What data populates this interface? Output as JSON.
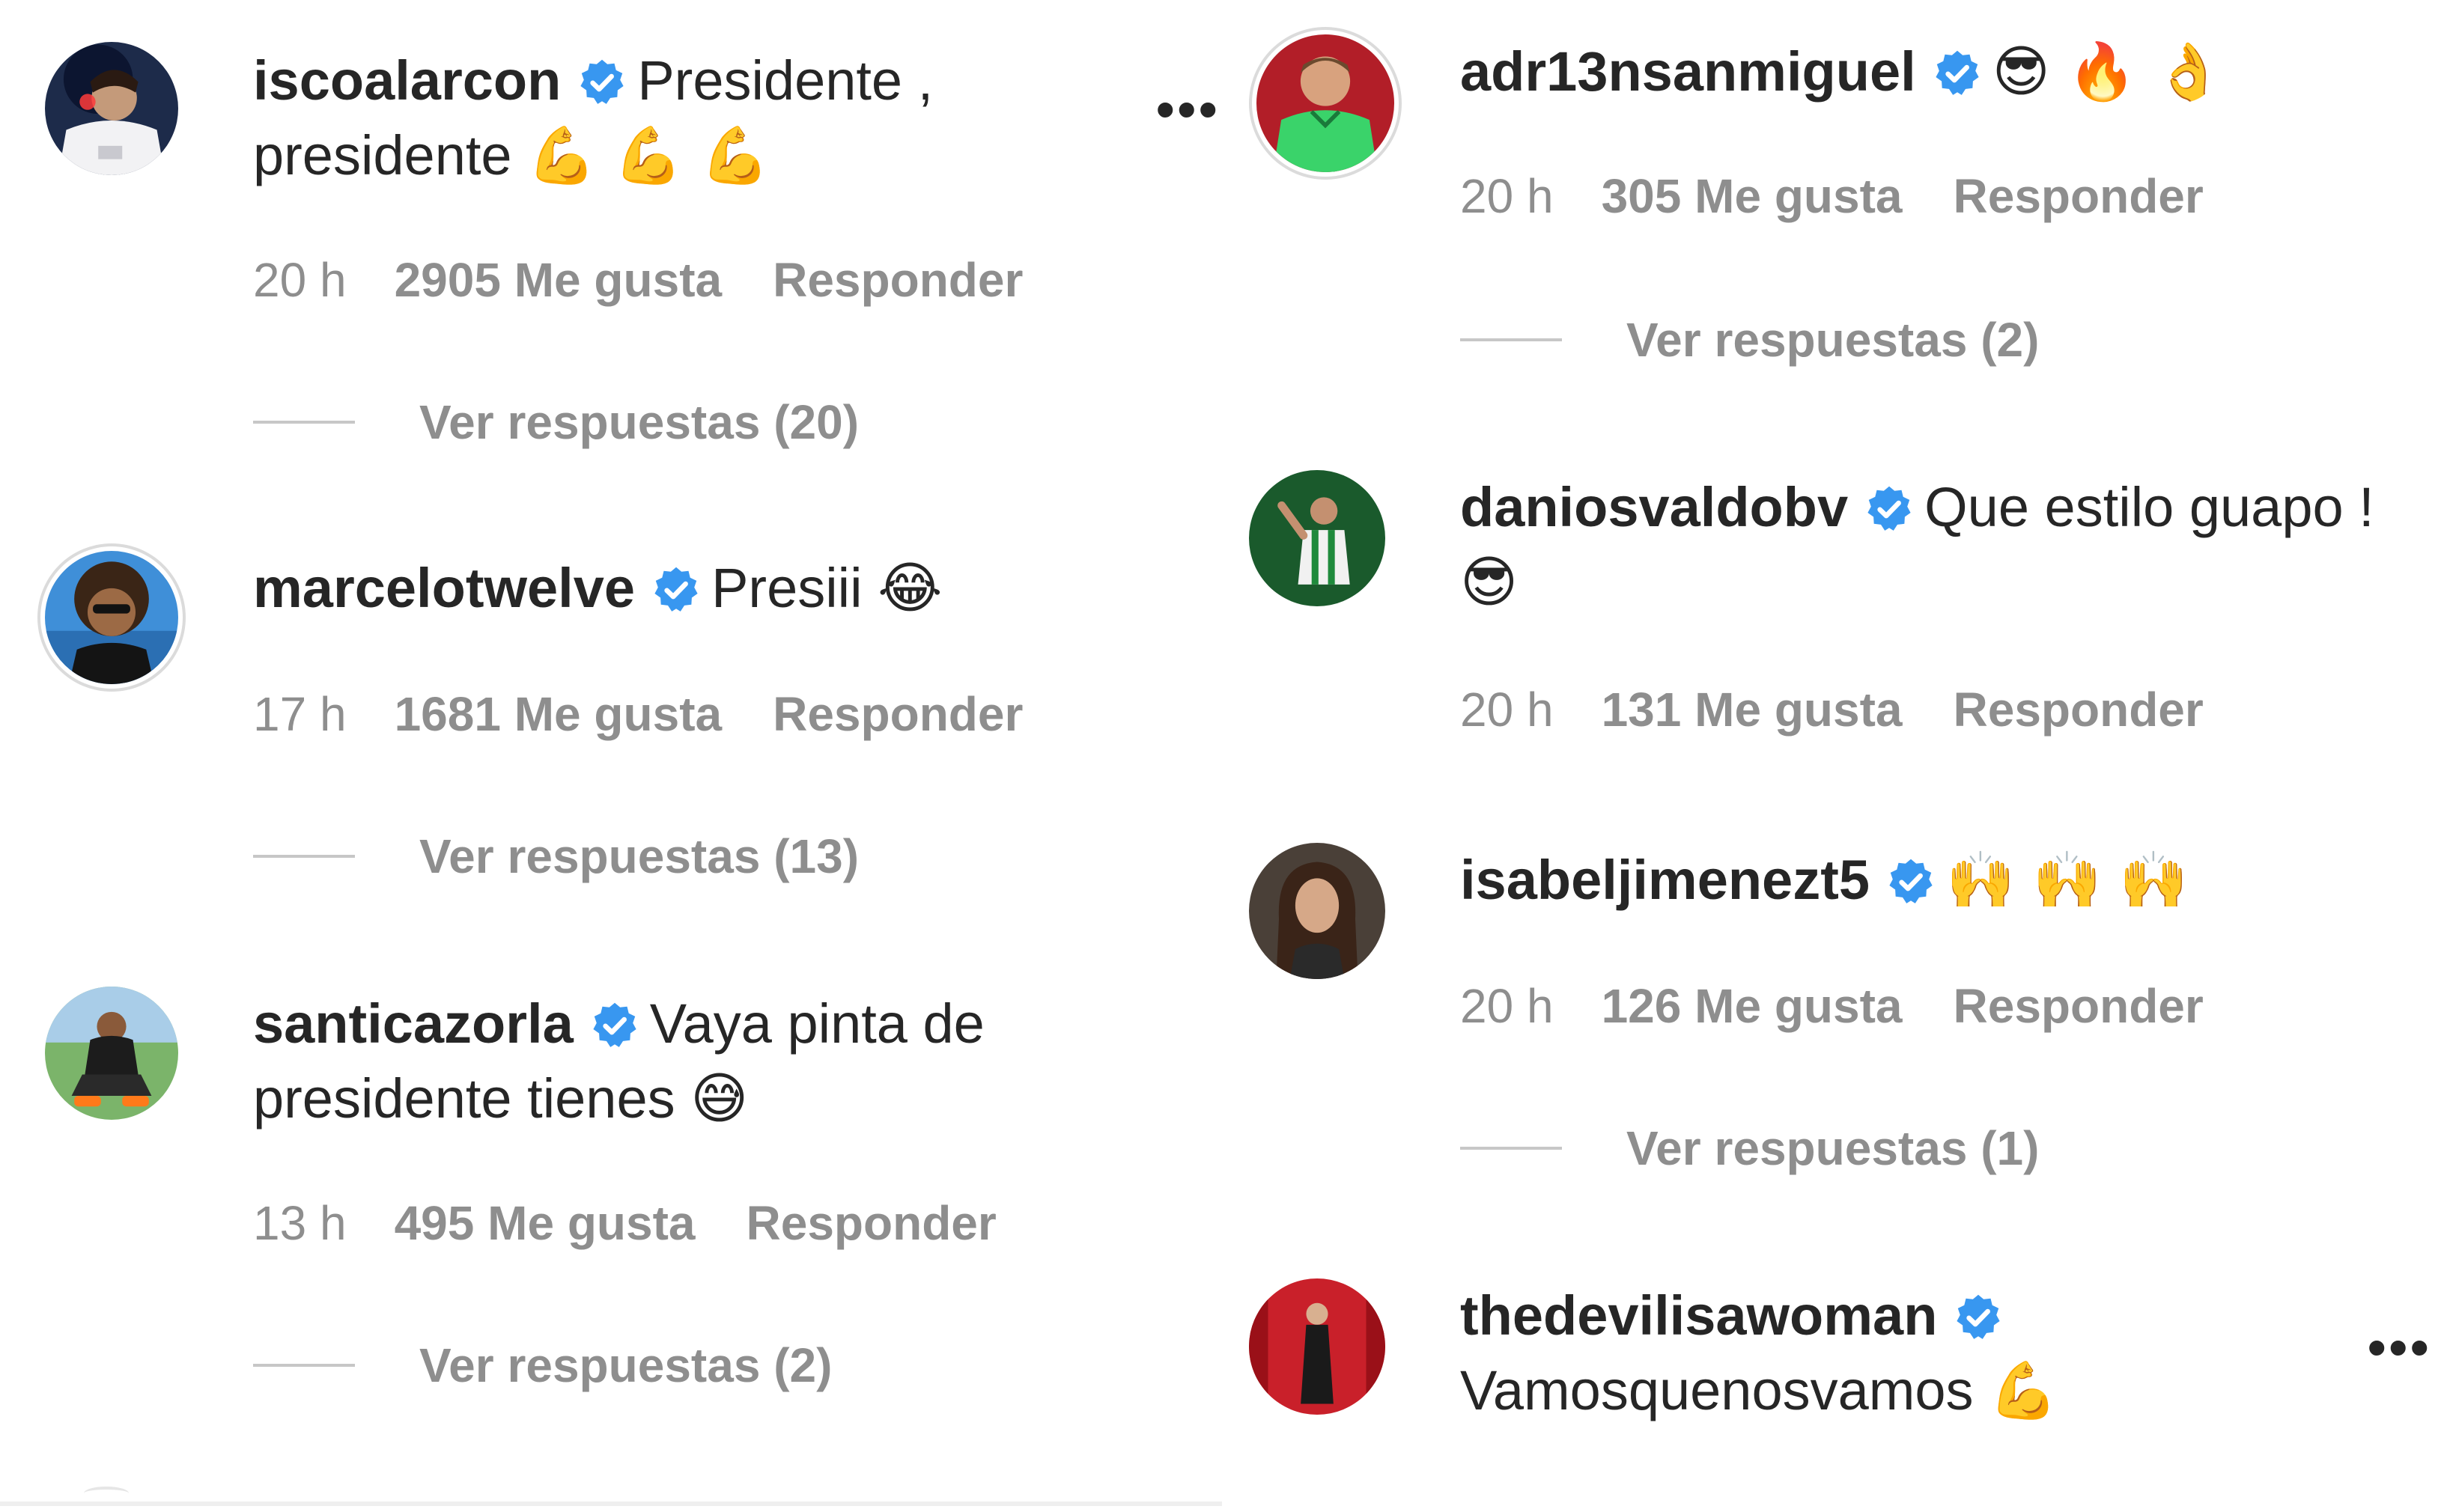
{
  "verified_color": "#3897f0",
  "text_color": "#262626",
  "meta_color": "#8e8e8e",
  "comments": [
    {
      "username": "iscoalarcon",
      "line1": "Presidente ,",
      "line2": "presidente",
      "emoji": "💪 💪 💪",
      "time": "20 h",
      "likes": "2905 Me gusta",
      "reply": "Responder",
      "replies": "Ver respuestas (20)"
    },
    {
      "username": "marcelotwelve",
      "text": "Presiii",
      "emoji": "😂",
      "time": "17 h",
      "likes": "1681 Me gusta",
      "reply": "Responder",
      "replies": "Ver respuestas (13)"
    },
    {
      "username": "santicazorla",
      "line1": "Vaya pinta de",
      "line2": "presidente tienes",
      "emoji": "😅",
      "time": "13 h",
      "likes": "495 Me gusta",
      "reply": "Responder",
      "replies": "Ver respuestas (2)"
    },
    {
      "username": "adr13nsanmiguel",
      "emoji": "😎 🔥 👌",
      "time": "20 h",
      "likes": "305 Me gusta",
      "reply": "Responder",
      "replies": "Ver respuestas (2)"
    },
    {
      "username": "daniosvaldobv",
      "line1": "Que estilo guapo !",
      "emoji": "😎",
      "time": "20 h",
      "likes": "131 Me gusta",
      "reply": "Responder"
    },
    {
      "username": "isabeljimenezt5",
      "emoji": "🙌 🙌 🙌",
      "time": "20 h",
      "likes": "126 Me gusta",
      "reply": "Responder",
      "replies": "Ver respuestas (1)"
    },
    {
      "username": "thedevilisawoman",
      "line2": "Vamosquenosvamos",
      "emoji": "💪"
    }
  ],
  "more_glyph": "•••"
}
